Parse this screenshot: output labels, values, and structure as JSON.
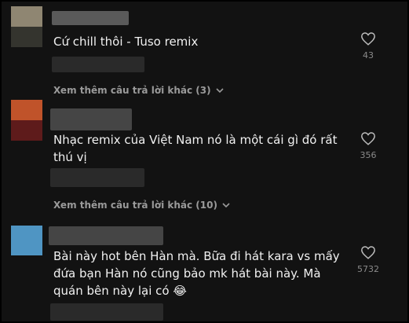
{
  "comments": [
    {
      "text": "Cứ chill thôi - Tuso remix",
      "likes": "43",
      "avatar_colors": [
        "#9a8f7a",
        "#3a3a34"
      ]
    },
    {
      "text": "Nhạc remix của Việt Nam nó là một cái gì đó rất thú vị",
      "likes": "356",
      "avatar_colors": [
        "#c2562c",
        "#6a1d1d"
      ]
    },
    {
      "text": "Bài này hot bên Hàn mà. Bữa đi hát kara vs mấy đứa bạn Hàn nó cũng bảo mk hát bài này. Mà quán bên này lại có 😂",
      "likes": "5732",
      "avatar_colors": [
        "#4f95c3",
        "#4f95c3"
      ]
    }
  ],
  "replies": [
    {
      "label": "Xem thêm câu trả lời khác (3)"
    },
    {
      "label": "Xem thêm câu trả lời khác (10)"
    }
  ],
  "icons": {
    "like": "heart-icon",
    "expand": "chevron-down-icon"
  }
}
